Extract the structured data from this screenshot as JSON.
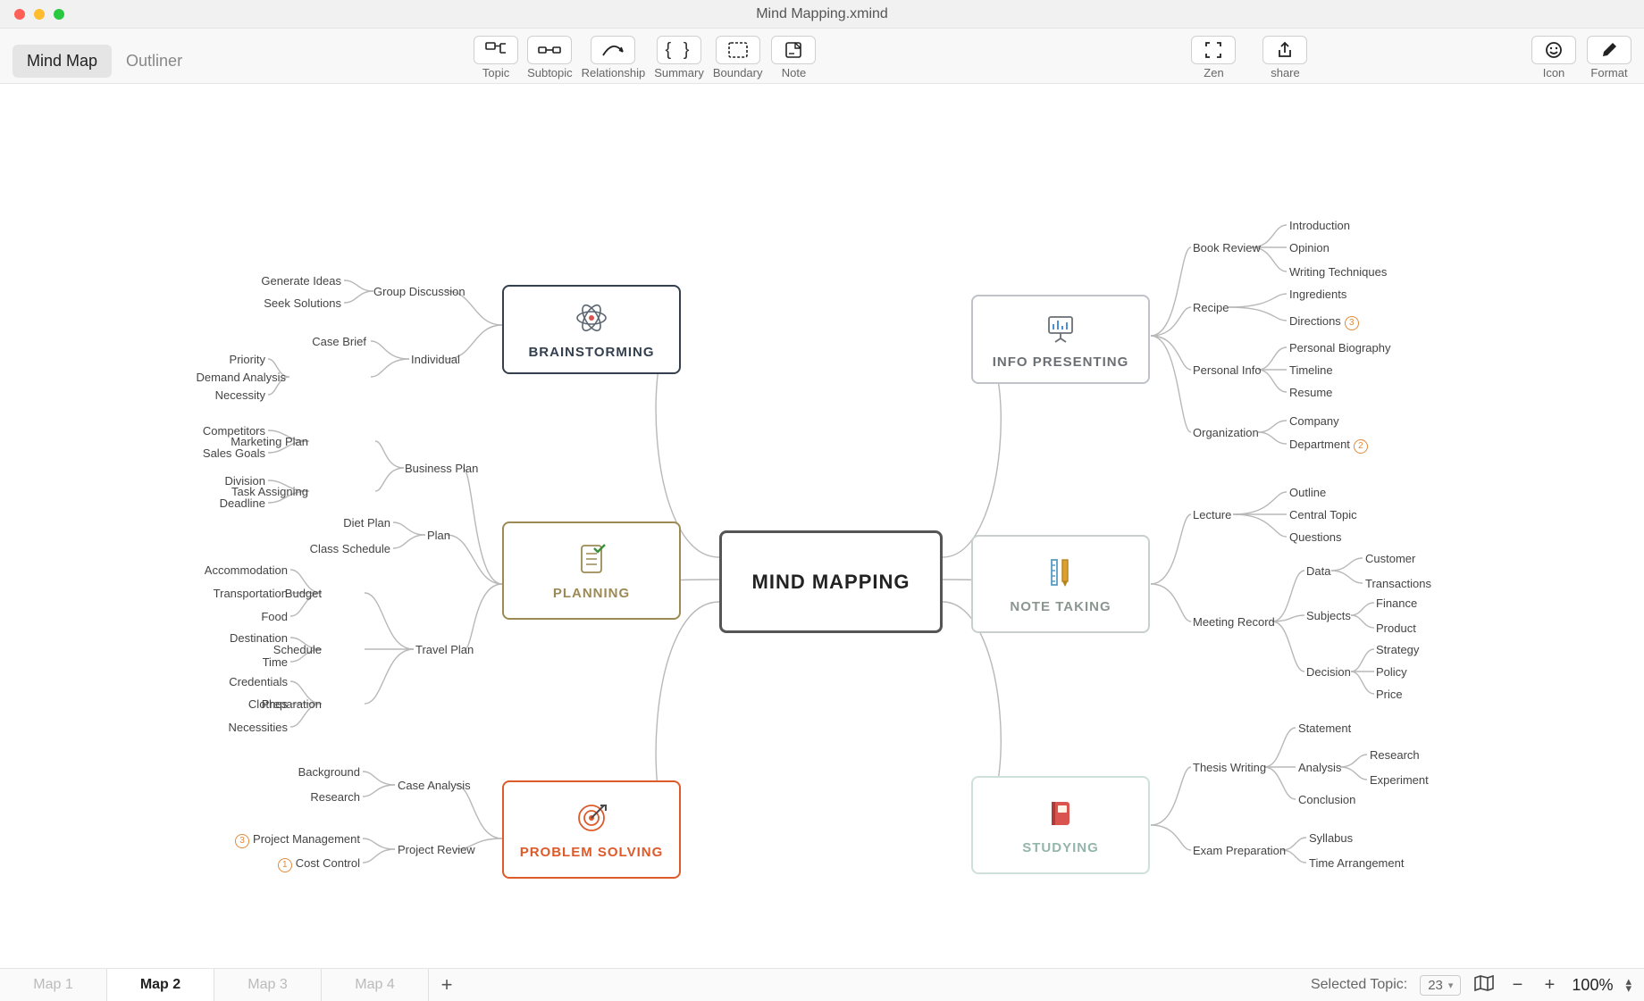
{
  "window": {
    "title": "Mind Mapping.xmind"
  },
  "modes": {
    "mindmap": "Mind Map",
    "outliner": "Outliner"
  },
  "tools": {
    "topic": "Topic",
    "subtopic": "Subtopic",
    "relationship": "Relationship",
    "summary": "Summary",
    "boundary": "Boundary",
    "note": "Note",
    "zen": "Zen",
    "share": "share",
    "icon": "Icon",
    "format": "Format"
  },
  "map": {
    "central": "MIND MAPPING",
    "branches": [
      {
        "id": "brainstorming",
        "label": "BRAINSTORMING",
        "color": "#2f3a4a",
        "children": [
          {
            "label": "Group Discussion",
            "children": [
              {
                "label": "Generate Ideas"
              },
              {
                "label": "Seek Solutions"
              }
            ]
          },
          {
            "label": "Individual",
            "children": [
              {
                "label": "Case Brief"
              },
              {
                "label": "Demand Analysis",
                "children": [
                  {
                    "label": "Priority"
                  },
                  {
                    "label": "Necessity"
                  }
                ]
              }
            ]
          }
        ]
      },
      {
        "id": "planning",
        "label": "PLANNING",
        "color": "#9c8a55",
        "children": [
          {
            "label": "Business Plan",
            "children": [
              {
                "label": "Marketing Plan",
                "children": [
                  {
                    "label": "Competitors"
                  },
                  {
                    "label": "Sales Goals"
                  }
                ]
              },
              {
                "label": "Task Assigning",
                "children": [
                  {
                    "label": "Division"
                  },
                  {
                    "label": "Deadline"
                  }
                ]
              }
            ]
          },
          {
            "label": "Plan",
            "children": [
              {
                "label": "Diet Plan"
              },
              {
                "label": "Class Schedule"
              }
            ]
          },
          {
            "label": "Travel Plan",
            "children": [
              {
                "label": "Budget",
                "children": [
                  {
                    "label": "Accommodation"
                  },
                  {
                    "label": "Transportation"
                  },
                  {
                    "label": "Food"
                  }
                ]
              },
              {
                "label": "Schedule",
                "children": [
                  {
                    "label": "Destination"
                  },
                  {
                    "label": "Time"
                  }
                ]
              },
              {
                "label": "Preparation",
                "children": [
                  {
                    "label": "Credentials"
                  },
                  {
                    "label": "Clothes"
                  },
                  {
                    "label": "Necessities"
                  }
                ]
              }
            ]
          }
        ]
      },
      {
        "id": "problem_solving",
        "label": "PROBLEM SOLVING",
        "color": "#dd5a2a",
        "children": [
          {
            "label": "Case Analysis",
            "children": [
              {
                "label": "Background"
              },
              {
                "label": "Research"
              }
            ]
          },
          {
            "label": "Project Review",
            "children": [
              {
                "label": "Project Management",
                "badge": "3"
              },
              {
                "label": "Cost Control",
                "badge": "1"
              }
            ]
          }
        ]
      },
      {
        "id": "info_presenting",
        "label": "INFO PRESENTING",
        "color": "#6b6f74",
        "children": [
          {
            "label": "Book Review",
            "children": [
              {
                "label": "Introduction"
              },
              {
                "label": "Opinion"
              },
              {
                "label": "Writing Techniques"
              }
            ]
          },
          {
            "label": "Recipe",
            "children": [
              {
                "label": "Ingredients"
              },
              {
                "label": "Directions",
                "badge_after": "3"
              }
            ]
          },
          {
            "label": "Personal Info",
            "children": [
              {
                "label": "Personal Biography"
              },
              {
                "label": "Timeline"
              },
              {
                "label": "Resume"
              }
            ]
          },
          {
            "label": "Organization",
            "children": [
              {
                "label": "Company"
              },
              {
                "label": "Department",
                "badge_after": "2"
              }
            ]
          }
        ]
      },
      {
        "id": "note_taking",
        "label": "NOTE TAKING",
        "color": "#9ba7a0",
        "children": [
          {
            "label": "Lecture",
            "children": [
              {
                "label": "Outline"
              },
              {
                "label": "Central Topic"
              },
              {
                "label": "Questions"
              }
            ]
          },
          {
            "label": "Meeting Record",
            "children": [
              {
                "label": "Data",
                "children": [
                  {
                    "label": "Customer"
                  },
                  {
                    "label": "Transactions"
                  }
                ]
              },
              {
                "label": "Subjects",
                "children": [
                  {
                    "label": "Finance"
                  },
                  {
                    "label": "Product"
                  }
                ]
              },
              {
                "label": "Decision",
                "children": [
                  {
                    "label": "Strategy"
                  },
                  {
                    "label": "Policy"
                  },
                  {
                    "label": "Price"
                  }
                ]
              }
            ]
          }
        ]
      },
      {
        "id": "studying",
        "label": "STUDYING",
        "color": "#a8c9c0",
        "children": [
          {
            "label": "Thesis Writing",
            "children": [
              {
                "label": "Statement"
              },
              {
                "label": "Analysis",
                "children": [
                  {
                    "label": "Research"
                  },
                  {
                    "label": "Experiment"
                  }
                ]
              },
              {
                "label": "Conclusion"
              }
            ]
          },
          {
            "label": "Exam Preparation",
            "children": [
              {
                "label": "Syllabus"
              },
              {
                "label": "Time Arrangement"
              }
            ]
          }
        ]
      }
    ]
  },
  "sheets": {
    "active": "Map 2",
    "items": [
      "Map 1",
      "Map 2",
      "Map 3",
      "Map 4"
    ]
  },
  "status": {
    "selected_label": "Selected Topic:",
    "selected_count": "23",
    "zoom": "100%"
  }
}
